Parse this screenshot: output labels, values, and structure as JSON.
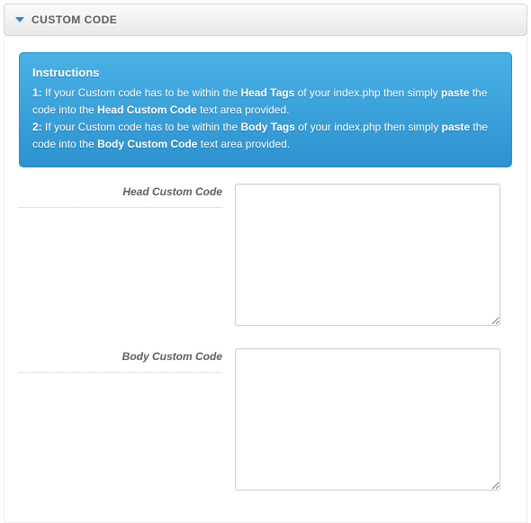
{
  "panel": {
    "title": "CUSTOM CODE"
  },
  "instructions": {
    "heading": "Instructions",
    "line1_prefix": "1:",
    "line1_a": " If your Custom code has to be within the ",
    "line1_b_bold": "Head Tags",
    "line1_c": " of your index.php then simply ",
    "line1_d_bold": "paste",
    "line1_e": " the code into the ",
    "line1_f_bold": "Head Custom Code",
    "line1_g": " text area provided.",
    "line2_prefix": "2:",
    "line2_a": " If your Custom code has to be within the ",
    "line2_b_bold": "Body Tags",
    "line2_c": " of your index.php then simply ",
    "line2_d_bold": "paste",
    "line2_e": " the code into the ",
    "line2_f_bold": "Body Custom Code",
    "line2_g": " text area provided."
  },
  "fields": {
    "head": {
      "label": "Head Custom Code",
      "value": ""
    },
    "body": {
      "label": "Body Custom Code",
      "value": ""
    }
  }
}
